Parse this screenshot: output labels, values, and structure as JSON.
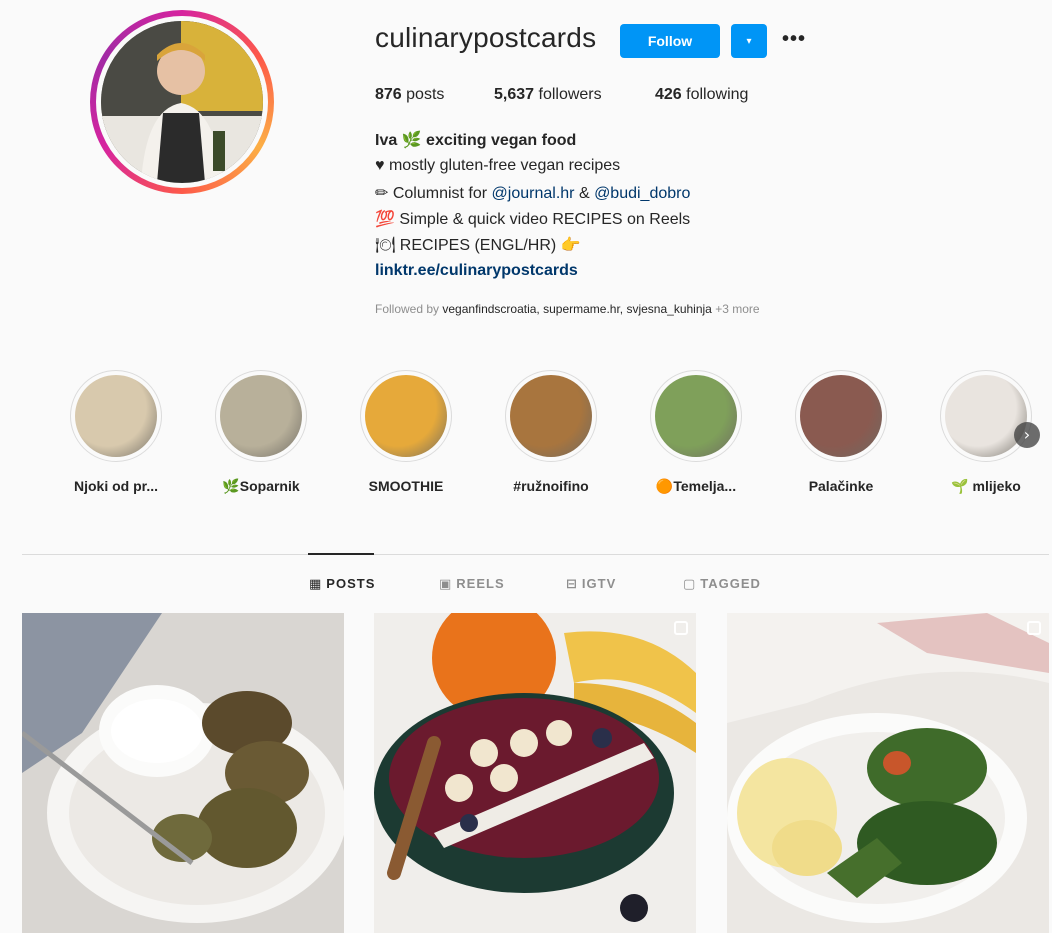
{
  "profile": {
    "username": "culinarypostcards",
    "follow_label": "Follow",
    "dropdown_icon": "▾",
    "more_icon": "•••",
    "stats": {
      "posts_count": "876",
      "posts_label": "posts",
      "followers_count": "5,637",
      "followers_label": "followers",
      "following_count": "426",
      "following_label": "following"
    },
    "bio": {
      "name": "Iva 🌿 exciting vegan food",
      "line1": "♥ mostly gluten-free vegan recipes",
      "line2_prefix": "✏ Columnist for ",
      "line2_mention1": "@journal.hr",
      "line2_amp": " & ",
      "line2_mention2": "@budi_dobro",
      "line3": "💯 Simple & quick video RECIPES on Reels",
      "line4": "🍽 RECIPES (ENGL/HR) 👉",
      "link": "linktr.ee/culinarypostcards"
    },
    "followed_by_prefix": "Followed by ",
    "followed_by_names": "veganfindscroatia, supermame.hr, svjesna_kuhinja",
    "followed_by_more": " +3 more"
  },
  "highlights": [
    {
      "label": "Njoki od pr...",
      "color": "#d8c9ad"
    },
    {
      "label": "🌿Soparnik",
      "color": "#b8b09a"
    },
    {
      "label": "SMOOTHIE",
      "color": "#e6a93a"
    },
    {
      "label": "#ružnoifino",
      "color": "#a8753e"
    },
    {
      "label": "🟠Temelja...",
      "color": "#7fa05a"
    },
    {
      "label": "Palačinke",
      "color": "#8a5a50"
    },
    {
      "label": "🌱 mlijeko",
      "color": "#e9e4df"
    }
  ],
  "highlights_next_icon": "›",
  "tabs": [
    {
      "label": "POSTS",
      "icon": "▦"
    },
    {
      "label": "REELS",
      "icon": "▣"
    },
    {
      "label": "IGTV",
      "icon": "⊟"
    },
    {
      "label": "TAGGED",
      "icon": "▢"
    }
  ],
  "posts": [
    {
      "subject": "falafel patties with yogurt dip",
      "colors": [
        "#d9d6d2",
        "#5c6b3a"
      ]
    },
    {
      "subject": "smoothie bowl with banana and coconut",
      "colors": [
        "#f0eeeb",
        "#6b1a2e"
      ]
    },
    {
      "subject": "stuffed cabbage rolls with potatoes",
      "colors": [
        "#ebe8e4",
        "#3f6b2a"
      ]
    }
  ]
}
